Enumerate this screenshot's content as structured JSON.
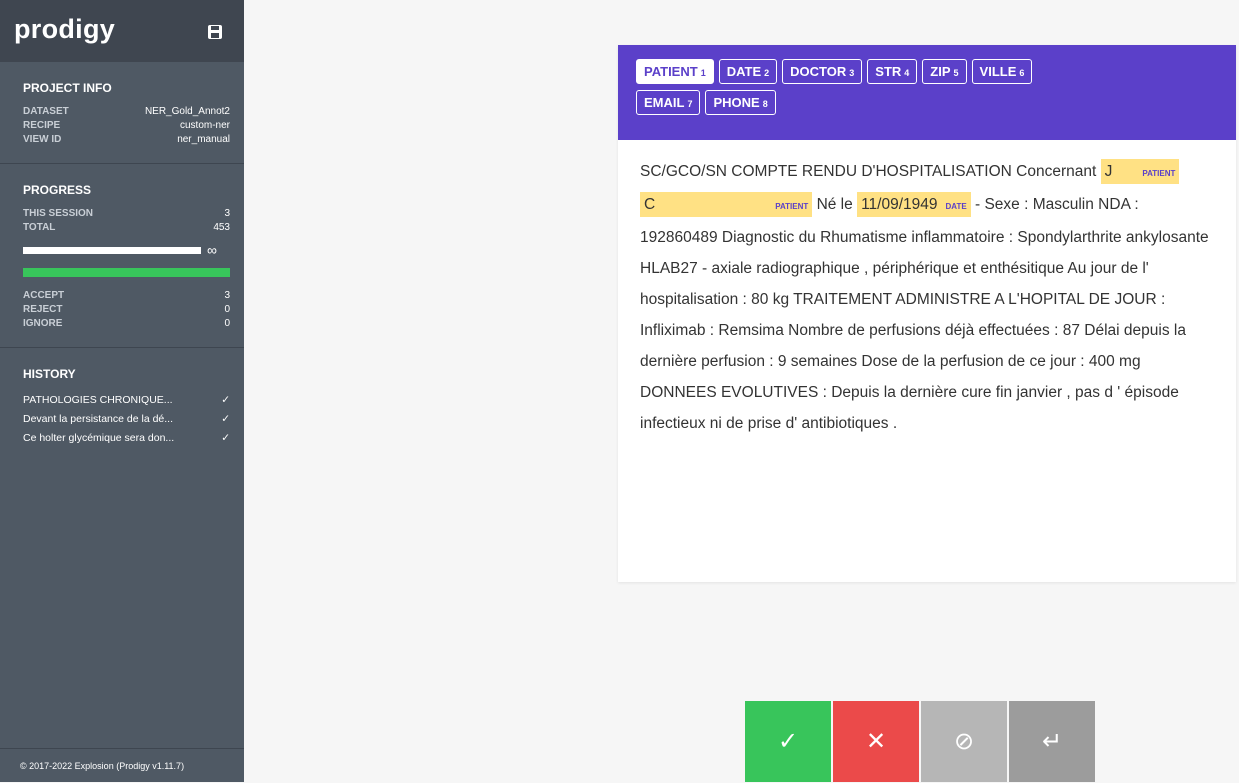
{
  "app": {
    "name": "prodigy"
  },
  "project_info": {
    "title": "PROJECT INFO",
    "rows": [
      {
        "k": "DATASET",
        "v": "NER_Gold_Annot2"
      },
      {
        "k": "RECIPE",
        "v": "custom-ner"
      },
      {
        "k": "VIEW ID",
        "v": "ner_manual"
      }
    ]
  },
  "progress": {
    "title": "PROGRESS",
    "this_session_label": "THIS SESSION",
    "this_session": "3",
    "total_label": "TOTAL",
    "total": "453",
    "infinity": "∞",
    "accept_label": "ACCEPT",
    "accept": "3",
    "reject_label": "REJECT",
    "reject": "0",
    "ignore_label": "IGNORE",
    "ignore": "0"
  },
  "history": {
    "title": "HISTORY",
    "items": [
      {
        "text": "PATHOLOGIES CHRONIQUE...",
        "check": "✓"
      },
      {
        "text": "Devant la persistance de la dé...",
        "check": "✓"
      },
      {
        "text": "Ce holter glycémique sera don...",
        "check": "✓"
      }
    ]
  },
  "footer": "© 2017-2022 Explosion   (Prodigy v1.11.7)",
  "labels": [
    {
      "name": "PATIENT",
      "key": "1"
    },
    {
      "name": "DATE",
      "key": "2"
    },
    {
      "name": "DOCTOR",
      "key": "3"
    },
    {
      "name": "STR",
      "key": "4"
    },
    {
      "name": "ZIP",
      "key": "5"
    },
    {
      "name": "VILLE",
      "key": "6"
    },
    {
      "name": "EMAIL",
      "key": "7"
    },
    {
      "name": "PHONE",
      "key": "8"
    }
  ],
  "text": {
    "p1": "SC/GCO/SN COMPTE RENDU D'HOSPITALISATION Concernant",
    "e1": {
      "text": "J",
      "tag": "PATIENT"
    },
    "e2": {
      "text": "C",
      "tag": "PATIENT"
    },
    "p2": "Né le",
    "e3": {
      "text": "11/09/1949",
      "tag": "DATE"
    },
    "p3": "- Sexe : Masculin NDA : 192860489 Diagnostic du Rhumatisme inflammatoire : Spondylarthrite ankylosante HLAB27 - axiale radiographique , périphérique et enthésitique Au jour de l' hospitalisation : 80 kg TRAITEMENT ADMINISTRE A L'HOPITAL DE JOUR : Infliximab : Remsima Nombre de perfusions déjà effectuées : 87 Délai depuis la dernière perfusion : 9 semaines Dose de la perfusion de ce jour : 400 mg DONNEES EVOLUTIVES : Depuis la dernière cure fin janvier , pas d ' épisode infectieux ni de prise d' antibiotiques ."
  },
  "actions": {
    "accept": "✓",
    "reject": "✕",
    "ignore": "⊘",
    "undo": "↵",
    "colors": {
      "accept": "#38c55b",
      "reject": "#eb4a4a",
      "ignore": "#b6b6b6",
      "undo": "#9c9c9c"
    }
  },
  "colors": {
    "accent": "#5b40c9",
    "highlight": "#ffe184",
    "sidebar": "#4f5964"
  }
}
